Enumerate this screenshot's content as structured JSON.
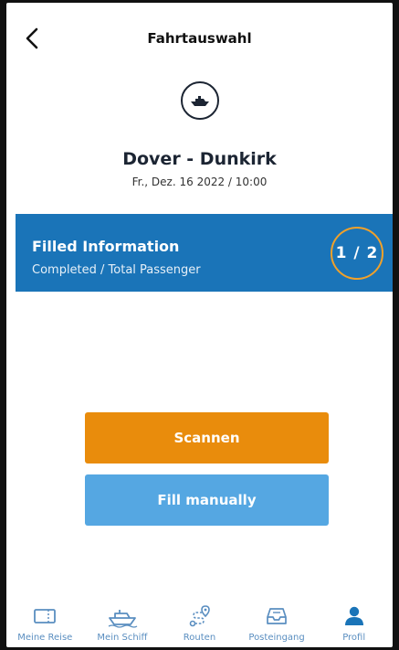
{
  "header": {
    "title": "Fahrtauswahl",
    "back_icon": "chevron-left-icon"
  },
  "trip": {
    "icon": "ship-icon",
    "route": "Dover - Dunkirk",
    "datetime": "Fr., Dez. 16 2022 / 10:00"
  },
  "info_banner": {
    "title": "Filled Information",
    "subtitle": "Completed / Total Passenger",
    "counter": "1 / 2",
    "background": "#1a74b8",
    "highlight_ring": "#f0a12a"
  },
  "actions": {
    "scan_label": "Scannen",
    "scan_color": "#e98c0c",
    "manual_label": "Fill manually",
    "manual_color": "#55a7e2"
  },
  "tabbar": {
    "items": [
      {
        "label": "Meine Reise",
        "icon": "ticket-icon"
      },
      {
        "label": "Mein Schiff",
        "icon": "ship-icon"
      },
      {
        "label": "Routen",
        "icon": "route-icon"
      },
      {
        "label": "Posteingang",
        "icon": "inbox-icon"
      },
      {
        "label": "Profil",
        "icon": "person-icon"
      }
    ]
  }
}
